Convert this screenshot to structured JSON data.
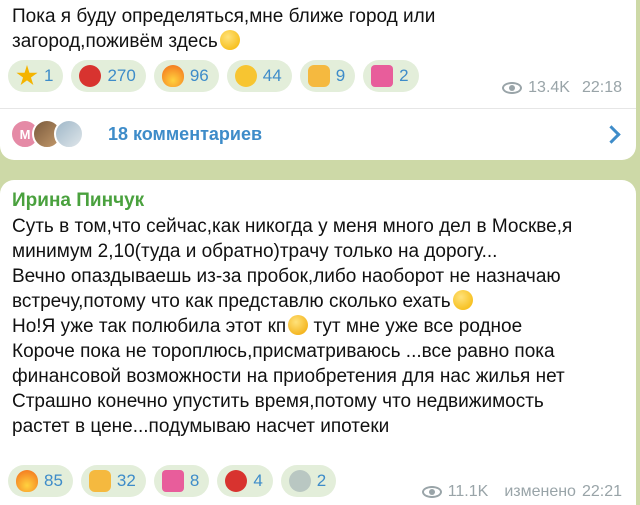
{
  "messages": [
    {
      "text": "Пока я буду определяться,мне ближе город или\nзагород,поживём здесь",
      "reactions": [
        {
          "icon": "star-icon",
          "color": "#f4b400",
          "count": "1"
        },
        {
          "icon": "heart-fire-icon",
          "color": "#d8332f",
          "count": "270"
        },
        {
          "icon": "fire-icon",
          "color": "#f26a1b",
          "count": "96"
        },
        {
          "icon": "heart-eyes-icon",
          "color": "#f7c531",
          "count": "44"
        },
        {
          "icon": "thumbs-up-icon",
          "color": "#f5b93f",
          "count": "9"
        },
        {
          "icon": "heart-gift-icon",
          "color": "#e85d9b",
          "count": "2"
        }
      ],
      "views": "13.4K",
      "time": "22:18",
      "comments": {
        "avatar_initial": "М",
        "label": "18 комментариев"
      }
    },
    {
      "author": "Ирина Пинчук",
      "text_part1": "Суть в том,что сейчас,как никогда у меня много дел в Москве,я\nминимум 2,10(туда и обратно)трачу только на дорогу...\nВечно опаздываешь из-за пробок,либо наоборот не назначаю\nвстречу,потому что как представлю сколько ехать",
      "text_part2": "\nНо!Я уже так полюбила этот кп",
      "text_part3": " тут мне уже все родное\nКороче пока не тороплюсь,присматриваюсь ...все равно пока\nфинансовой возможности на приобретения для нас жилья нет\nСтрашно конечно упустить время,потому что недвижимость\nрастет в цене...подумываю насчет ипотеки",
      "reactions": [
        {
          "icon": "fire-icon",
          "color": "#f26a1b",
          "count": "85"
        },
        {
          "icon": "thumbs-up-icon",
          "color": "#f5b93f",
          "count": "32"
        },
        {
          "icon": "heart-gift-icon",
          "color": "#e85d9b",
          "count": "8"
        },
        {
          "icon": "heart-fire-icon",
          "color": "#d8332f",
          "count": "4"
        },
        {
          "icon": "dove-icon",
          "color": "#b9c7c2",
          "count": "2"
        }
      ],
      "views": "11.1K",
      "edited": "изменено",
      "time": "22:21"
    }
  ],
  "colors": {
    "background": "#cdd9a7",
    "accent": "#3e8cc9",
    "author": "#4aa13e",
    "reaction_bg": "#e3eeda"
  }
}
